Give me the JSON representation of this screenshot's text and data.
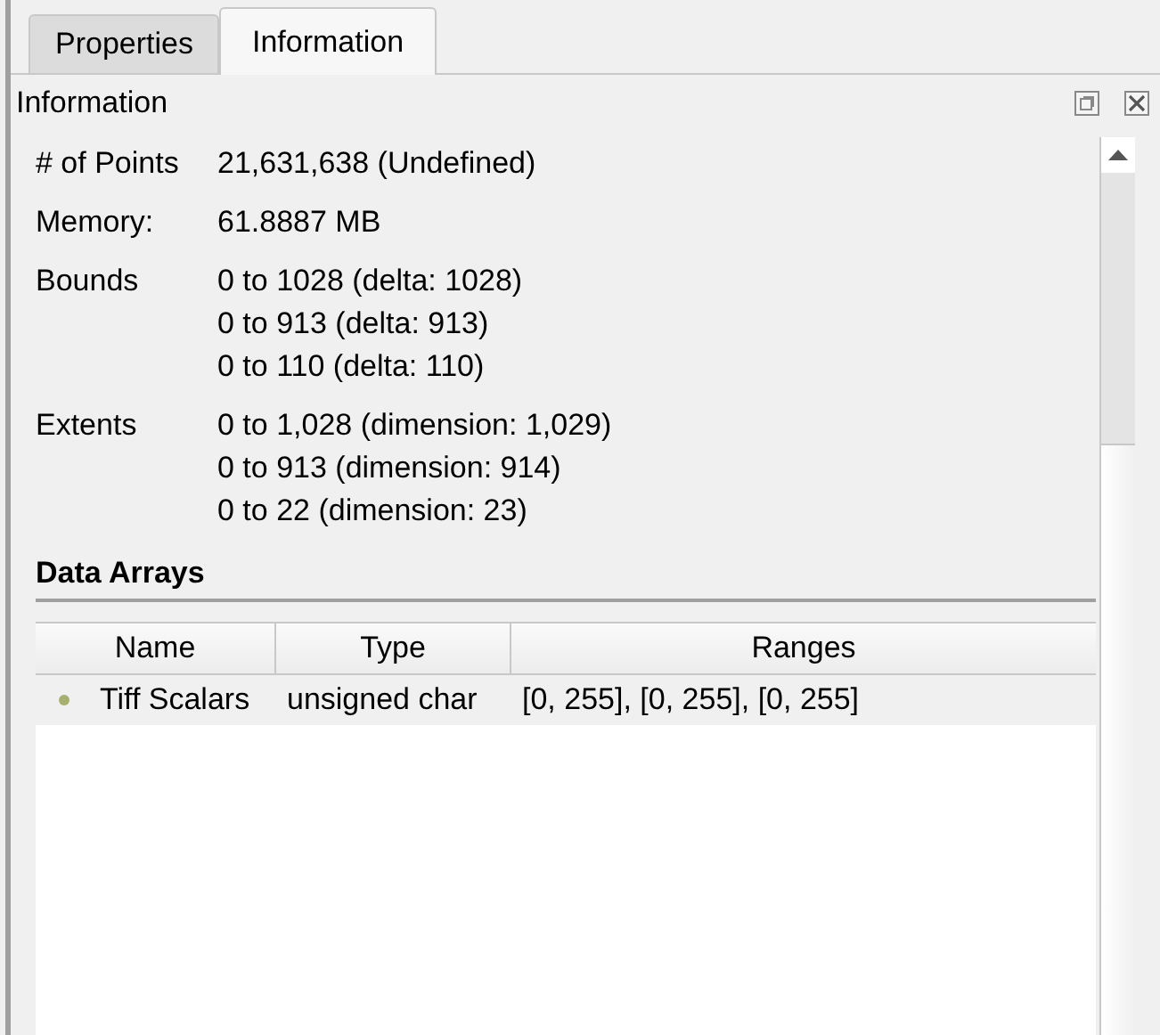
{
  "tabs": [
    {
      "label": "Properties",
      "selected": false
    },
    {
      "label": "Information",
      "selected": true
    }
  ],
  "panel": {
    "title": "Information"
  },
  "info": [
    {
      "label": "# of Points",
      "values": [
        "21,631,638 (Undefined)"
      ]
    },
    {
      "label": "Memory:",
      "values": [
        "61.8887 MB"
      ]
    },
    {
      "label": "Bounds",
      "values": [
        "0 to 1028 (delta: 1028)",
        "0 to 913 (delta: 913)",
        "0 to 110 (delta: 110)"
      ]
    },
    {
      "label": "Extents",
      "values": [
        "0 to 1,028 (dimension: 1,029)",
        "0 to 913 (dimension: 914)",
        "0 to 22 (dimension: 23)"
      ]
    }
  ],
  "data_arrays": {
    "title": "Data Arrays",
    "columns": [
      "Name",
      "Type",
      "Ranges"
    ],
    "rows": [
      {
        "cells": [
          "Tiff Scalars",
          "unsigned char",
          "[0, 255], [0, 255], [0, 255]"
        ],
        "selected": false
      }
    ]
  }
}
